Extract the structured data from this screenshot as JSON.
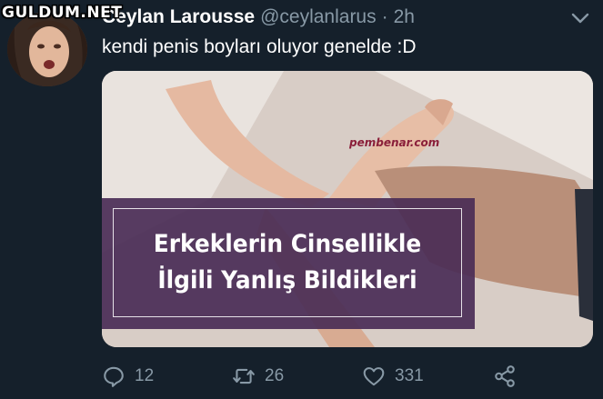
{
  "watermark": "GULDUM.NET",
  "tweet": {
    "display_name": "Ceylan Larousse",
    "handle": "@ceylanlarus",
    "separator": "·",
    "time": "2h",
    "text": "kendi penis boyları oluyor genelde :D"
  },
  "media": {
    "brand": "pembenar.com",
    "banner_lines": [
      "Erkeklerin Cinsellikle",
      "İlgili Yanlış Bildikleri"
    ]
  },
  "actions": {
    "reply_count": "12",
    "retweet_count": "26",
    "like_count": "331"
  },
  "colors": {
    "background": "#15202b",
    "muted": "#8899a6",
    "text": "#ffffff",
    "banner": "#4a2c56"
  },
  "icons": [
    "reply-icon",
    "retweet-icon",
    "like-icon",
    "share-icon",
    "chevron-down-icon"
  ]
}
